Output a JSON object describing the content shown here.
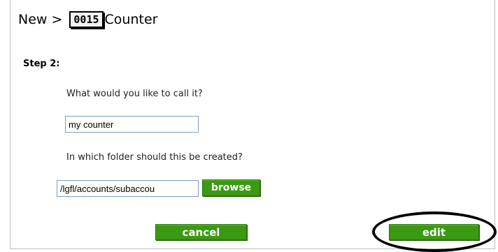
{
  "breadcrumb": {
    "new_label": "New >",
    "counter_badge": "0015",
    "page_name": "Counter"
  },
  "step": {
    "label": "Step 2:"
  },
  "form": {
    "name_question": "What would you like to call it?",
    "name_value": "my counter",
    "folder_question": "In which folder should this be created?",
    "folder_value": "/lgfl/accounts/subaccou",
    "browse_label": "browse"
  },
  "actions": {
    "cancel_label": "cancel",
    "edit_label": "edit"
  },
  "colors": {
    "button_green": "#3a9a12",
    "annotation_oval": "#000000"
  }
}
